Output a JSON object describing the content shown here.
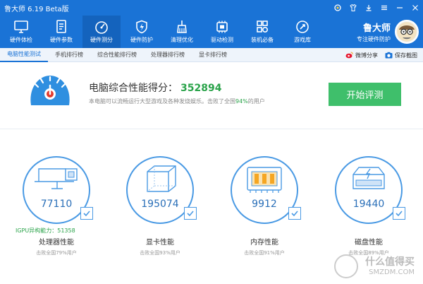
{
  "app": {
    "title": "鲁大师 6.19 Beta版"
  },
  "toolbar": {
    "items": [
      {
        "label": "硬件体检",
        "icon": "monitor-icon"
      },
      {
        "label": "硬件参数",
        "icon": "document-icon"
      },
      {
        "label": "硬件测分",
        "icon": "speedometer-icon"
      },
      {
        "label": "硬件防护",
        "icon": "shield-icon"
      },
      {
        "label": "清理优化",
        "icon": "broom-icon"
      },
      {
        "label": "驱动检测",
        "icon": "chip-icon"
      },
      {
        "label": "装机必备",
        "icon": "apps-icon"
      },
      {
        "label": "游戏库",
        "icon": "rocket-icon"
      }
    ],
    "active_index": 2
  },
  "brand": {
    "name": "鲁大师",
    "slogan": "专注硬件防护"
  },
  "tabs": [
    "电脑性能测试",
    "手机排行榜",
    "综合性能排行榜",
    "处理器排行榜",
    "显卡排行榜"
  ],
  "share": {
    "weibo": "微博分享",
    "save": "保存截图"
  },
  "score": {
    "title": "电脑综合性能得分：",
    "value": "352894",
    "sub_prefix": "本电脑可以流畅运行大型游戏及各种发烧娱乐。击败了全国",
    "sub_pct": "94%",
    "sub_suffix": "的用户",
    "button": "开始评测"
  },
  "cards": [
    {
      "score": "77110",
      "extra": "IGPU异构能力：51358",
      "title": "处理器性能",
      "sub": "击败全国79%用户",
      "icon": "cpu-icon"
    },
    {
      "score": "195074",
      "extra": "",
      "title": "显卡性能",
      "sub": "击败全国93%用户",
      "icon": "graphics-card-icon"
    },
    {
      "score": "9912",
      "extra": "",
      "title": "内存性能",
      "sub": "击败全国91%用户",
      "icon": "memory-icon"
    },
    {
      "score": "19440",
      "extra": "",
      "title": "磁盘性能",
      "sub": "击败全国89%用户",
      "icon": "disk-icon"
    }
  ],
  "watermark": {
    "line1": "什么值得买",
    "line2": "SMZDM.COM"
  },
  "colors": {
    "accent": "#1a73d6",
    "green": "#2aa34a",
    "button": "#3fbf6b",
    "circle": "#4a9ae4"
  }
}
